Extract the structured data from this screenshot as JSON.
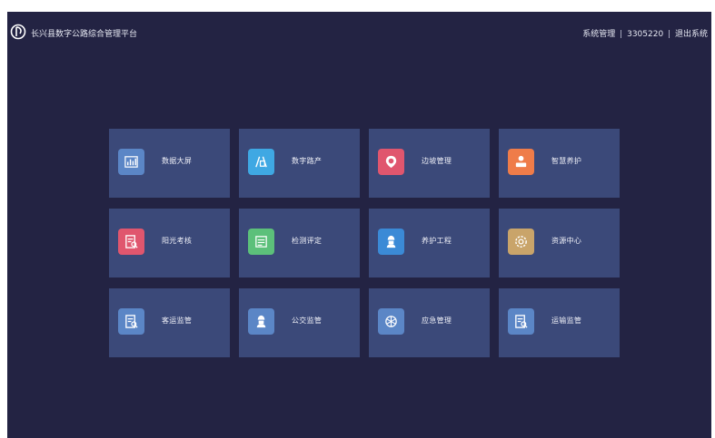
{
  "header": {
    "title": "长兴县数字公路综合管理平台",
    "nav": {
      "system_admin": "系统管理",
      "separator": "|",
      "user_id": "3305220",
      "logout": "退出系统"
    }
  },
  "modules": [
    {
      "label": "数据大屏",
      "icon": "chart-board-icon",
      "color": "#5b86c6"
    },
    {
      "label": "数字路产",
      "icon": "road-asset-icon",
      "color": "#3fa8e3"
    },
    {
      "label": "边坡管理",
      "icon": "slope-badge-icon",
      "color": "#e0566e"
    },
    {
      "label": "智慧养护",
      "icon": "maintenance-worker-icon",
      "color": "#ef7c49"
    },
    {
      "label": "阳光考核",
      "icon": "document-search-icon",
      "color": "#e0566e"
    },
    {
      "label": "检测评定",
      "icon": "inspection-doc-icon",
      "color": "#5cc07a"
    },
    {
      "label": "养护工程",
      "icon": "engineer-icon",
      "color": "#3b8ad6"
    },
    {
      "label": "资源中心",
      "icon": "resource-gear-icon",
      "color": "#c9a46a"
    },
    {
      "label": "客运监管",
      "icon": "document-search-icon",
      "color": "#5b86c6"
    },
    {
      "label": "公交监管",
      "icon": "engineer-icon",
      "color": "#5b86c6"
    },
    {
      "label": "应急管理",
      "icon": "emergency-icon",
      "color": "#5b86c6"
    },
    {
      "label": "运输监管",
      "icon": "document-search-icon",
      "color": "#5b86c6"
    }
  ],
  "colors": {
    "page_bg": "#232343",
    "tile_bg": "#3b4979"
  }
}
